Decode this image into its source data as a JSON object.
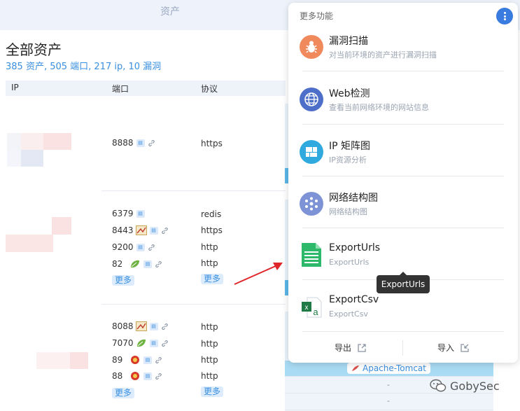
{
  "header": {
    "title": "资产"
  },
  "page": {
    "title": "全部资产",
    "summary": "385 资产, 505 端口, 217 ip, 10 漏洞"
  },
  "table": {
    "columns": [
      "IP",
      "端口",
      "协议"
    ],
    "more_label": "更多",
    "groups": [
      {
        "ports": [
          {
            "port": "8888",
            "protocol": "https"
          }
        ]
      },
      {
        "ports": [
          {
            "port": "6379",
            "protocol": "redis"
          },
          {
            "port": "8443",
            "protocol": "https"
          },
          {
            "port": "9200",
            "protocol": "http"
          },
          {
            "port": "82",
            "protocol": "http"
          }
        ]
      },
      {
        "ports": [
          {
            "port": "8088",
            "protocol": "http"
          },
          {
            "port": "7070",
            "protocol": "http"
          },
          {
            "port": "89",
            "protocol": "http"
          },
          {
            "port": "88",
            "protocol": "http"
          }
        ]
      }
    ],
    "product_tag": "Apache-Tomcat",
    "empty_value": "-"
  },
  "panel": {
    "header": "更多功能",
    "items": [
      {
        "title": "漏洞扫描",
        "subtitle": "对当前环境的资产进行漏洞扫描",
        "icon": "bug-icon",
        "color": "#f08a5d"
      },
      {
        "title": "Web检测",
        "subtitle": "查看当前网络环境的网站信息",
        "icon": "globe-icon",
        "color": "#4d6fc9"
      },
      {
        "title": "IP 矩阵图",
        "subtitle": "IP资源分析",
        "icon": "matrix-icon",
        "color": "#2fa9de"
      },
      {
        "title": "网络结构图",
        "subtitle": "网络结构图",
        "icon": "network-icon",
        "color": "#7d93d6"
      },
      {
        "title": "ExportUrls",
        "subtitle": "ExportUrls",
        "icon": "spreadsheet-icon",
        "color": "#2eb86a"
      },
      {
        "title": "ExportCsv",
        "subtitle": "ExportCsv",
        "icon": "excel-icon",
        "color": "#1f7a45"
      }
    ],
    "tooltip": "ExportUrls",
    "export_label": "导出",
    "import_label": "导入"
  },
  "watermark": {
    "text": "GobySec"
  }
}
